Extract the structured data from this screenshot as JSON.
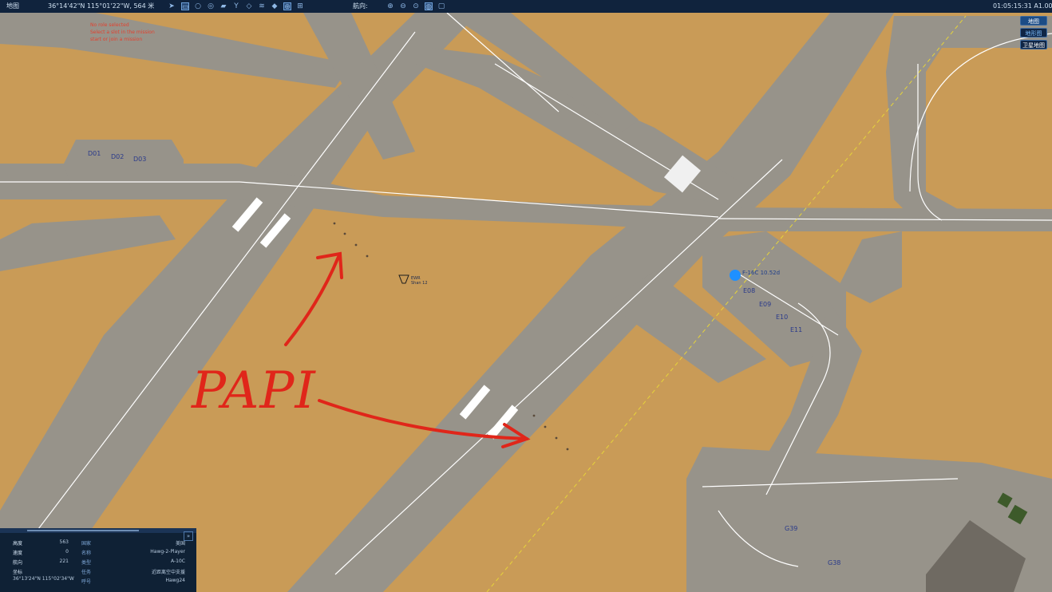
{
  "topbar": {
    "menu_label": "地图",
    "cursor_coords": "36°14'42\"N 115°01'22\"W, 564 米",
    "heading_label": "航向:",
    "clock": "01:05:15:31 A1.00",
    "tool_icons": [
      "send-icon",
      "ruler-icon",
      "circle-icon",
      "layers-icon",
      "vehicle-icon",
      "branch-icon",
      "target-icon",
      "radio-icon",
      "diamond-icon",
      "tower-icon",
      "compass-icon",
      "grid-icon"
    ],
    "zoom_icons": [
      "zoom-in-icon",
      "zoom-out-icon",
      "zoom-fit-icon",
      "globe-icon",
      "frame-icon"
    ]
  },
  "layers": {
    "map": "地图",
    "terrain": "地形图",
    "satellite": "卫星地图"
  },
  "warnings": [
    "No role selected",
    "Select a slot in the mission",
    "start or join a mission"
  ],
  "stands": {
    "d": [
      "D01",
      "D02",
      "D03"
    ],
    "e": [
      "E08",
      "E09",
      "E10",
      "E11"
    ],
    "g": [
      "G39",
      "G38"
    ]
  },
  "units": {
    "player_label": "F-16C  10.52d",
    "ground_unit_line1": "EWR",
    "ground_unit_line2": "Shan 12"
  },
  "annotation": {
    "text": "PAPI",
    "color": "#e0261a"
  },
  "info_panel": {
    "rows": [
      {
        "k": "高度",
        "v": "563"
      },
      {
        "k": "速度",
        "v": "0"
      },
      {
        "k": "航向",
        "v": "221"
      },
      {
        "k": "坐标",
        "v": ""
      }
    ],
    "coords": "36°13'24\"N 115°02'34\"W",
    "right_rows": [
      {
        "k": "国家",
        "v": "美国"
      },
      {
        "k": "名称",
        "v": "Hawg-2-Player"
      },
      {
        "k": "类型",
        "v": "A-10C"
      },
      {
        "k": "任务",
        "v": "近距离空中支援"
      },
      {
        "k": "呼号",
        "v": "Hawg24"
      }
    ]
  },
  "colors": {
    "ground": "#c99b57",
    "pavement": "#97938a",
    "markings": "#ffffff",
    "topbar": "#10233d",
    "annotation": "#e0261a",
    "boundary": "#e6d43a"
  }
}
